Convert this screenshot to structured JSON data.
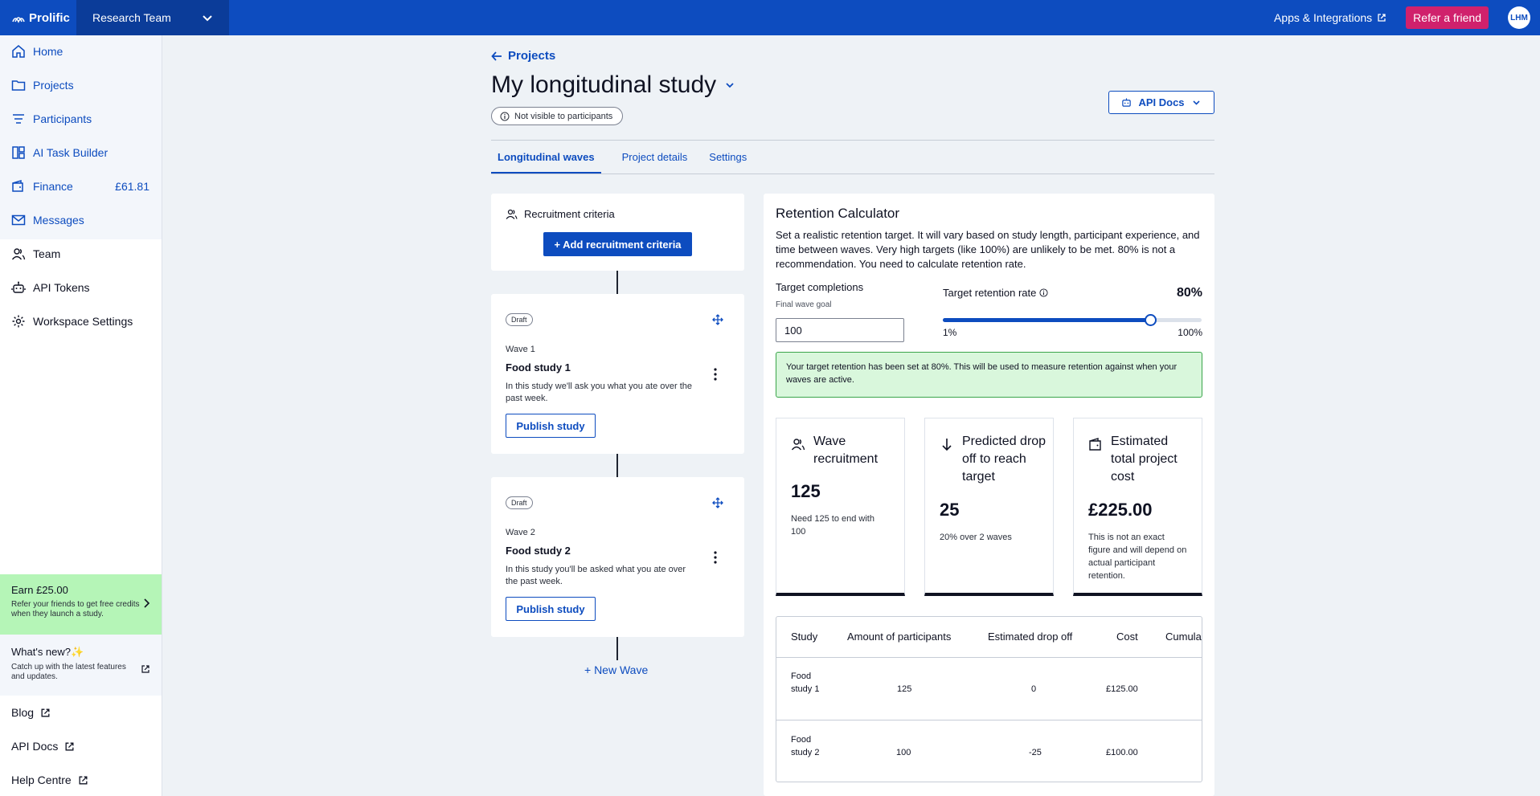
{
  "topbar": {
    "brand": "Prolific",
    "team": "Research Team",
    "apps_link": "Apps & Integrations",
    "refer_button": "Refer a friend",
    "avatar_initials": "LHM"
  },
  "sidebar": {
    "items": [
      {
        "label": "Home",
        "icon": "home-icon"
      },
      {
        "label": "Projects",
        "icon": "folder-icon"
      },
      {
        "label": "Participants",
        "icon": "filter-icon"
      },
      {
        "label": "AI Task Builder",
        "icon": "layout-icon"
      },
      {
        "label": "Finance",
        "icon": "wallet-icon",
        "amount": "£61.81"
      },
      {
        "label": "Messages",
        "icon": "mail-icon"
      },
      {
        "label": "Team",
        "icon": "users-icon"
      },
      {
        "label": "API Tokens",
        "icon": "robot-icon"
      },
      {
        "label": "Workspace Settings",
        "icon": "gear-icon"
      }
    ],
    "earn": {
      "title": "Earn £25.00",
      "desc": "Refer your friends to get free credits when they launch a study."
    },
    "whats_new": {
      "title": "What's new?✨",
      "desc": "Catch up with the latest features and updates."
    },
    "footer_links": [
      "Blog",
      "API Docs",
      "Help Centre"
    ]
  },
  "header": {
    "back_link": "Projects",
    "title": "My longitudinal study",
    "visibility": "Not visible to participants",
    "api_docs": "API Docs",
    "tabs": [
      "Longitudinal waves",
      "Project details",
      "Settings"
    ],
    "active_tab": "Longitudinal waves"
  },
  "recruitment": {
    "title": "Recruitment criteria",
    "add_button": "+ Add recruitment criteria"
  },
  "waves": [
    {
      "badge": "Draft",
      "label": "Wave 1",
      "name": "Food study 1",
      "desc": "In this study we'll ask you what you ate over the past week.",
      "publish": "Publish study"
    },
    {
      "badge": "Draft",
      "label": "Wave 2",
      "name": "Food study 2",
      "desc": "In this study you'll be asked what you ate over the past week.",
      "publish": "Publish study"
    }
  ],
  "new_wave": "+ New Wave",
  "calculator": {
    "title": "Retention Calculator",
    "desc": "Set a realistic retention target. It will vary based on study length, participant experience, and time between waves. Very high targets (like 100%) are unlikely to be met. 80% is not a recommendation. You need to calculate retention rate.",
    "target_completions_label": "Target completions",
    "target_completions_sub": "Final wave goal",
    "target_completions_value": "100",
    "retention_label": "Target retention rate",
    "retention_value": "80%",
    "retention_fraction": 0.8,
    "slider_min": "1%",
    "slider_max": "100%",
    "success_message": "Your target retention has been set at 80%. This will be used to measure retention against when your waves are active.",
    "stats": [
      {
        "icon": "users-icon",
        "title": "Wave recruitment",
        "value": "125",
        "desc": "Need 125 to end with 100"
      },
      {
        "icon": "arrow-down-icon",
        "title": "Predicted drop off to reach target",
        "value": "25",
        "desc": "20% over 2 waves"
      },
      {
        "icon": "wallet-icon",
        "title": "Estimated total project cost",
        "value": "£225.00",
        "desc": "This is not an exact figure and will depend on actual participant retention."
      }
    ],
    "table": {
      "headers": [
        "Study",
        "Amount of participants",
        "Estimated drop off",
        "Cost",
        "Cumula"
      ],
      "rows": [
        {
          "study": "Food study 1",
          "participants": "125",
          "drop_off": "0",
          "cost": "£125.00"
        },
        {
          "study": "Food study 2",
          "participants": "100",
          "drop_off": "-25",
          "cost": "£100.00"
        }
      ]
    }
  },
  "colors": {
    "brand_blue": "#0d4cbf",
    "refer_pink": "#d0216c",
    "earn_green": "#b5f5b7",
    "success_green": "#d9f7dc"
  }
}
